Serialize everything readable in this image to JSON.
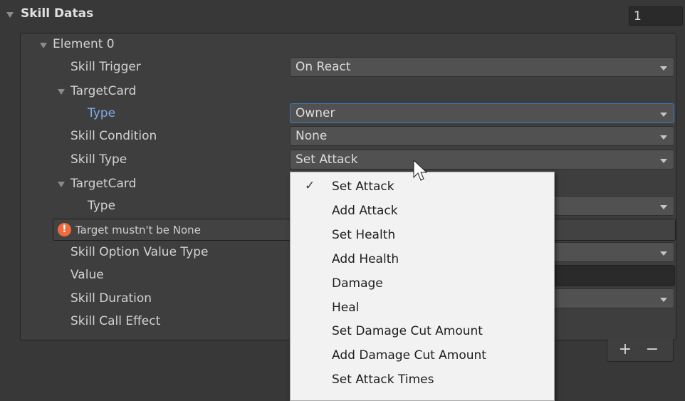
{
  "header": {
    "title": "Skill Datas",
    "size_value": "1"
  },
  "element": {
    "title": "Element 0",
    "fields": {
      "skill_trigger": {
        "label": "Skill Trigger",
        "value": "On React"
      },
      "target_card_1": {
        "label": "TargetCard",
        "type_label": "Type",
        "type_value": "Owner"
      },
      "skill_condition": {
        "label": "Skill Condition",
        "value": "None"
      },
      "skill_type": {
        "label": "Skill Type",
        "value": "Set Attack"
      },
      "target_card_2": {
        "label": "TargetCard",
        "type_label": "Type",
        "type_value": ""
      },
      "warning": "Target mustn't be None",
      "skill_option_value_type": {
        "label": "Skill Option Value Type",
        "value": ""
      },
      "value": {
        "label": "Value"
      },
      "skill_duration": {
        "label": "Skill Duration",
        "value": ""
      },
      "skill_call_effect": {
        "label": "Skill Call Effect"
      }
    }
  },
  "list_buttons": {
    "add": "+",
    "remove": "−"
  },
  "popup": {
    "selected_index": 0,
    "check_mark": "✓",
    "options": [
      "Set Attack",
      "Add Attack",
      "Set Health",
      "Add Health",
      "Damage",
      "Heal",
      "Set Damage Cut Amount",
      "Add Damage Cut Amount",
      "Set Attack Times"
    ]
  },
  "colors": {
    "background": "#383838",
    "panel": "#3e3e3e",
    "dropdown": "#515151",
    "focus_label": "#7fa9e8",
    "focus_border": "#3a79bb",
    "warning_icon": "#f06a3d",
    "popup_bg": "#f2f2f2"
  }
}
